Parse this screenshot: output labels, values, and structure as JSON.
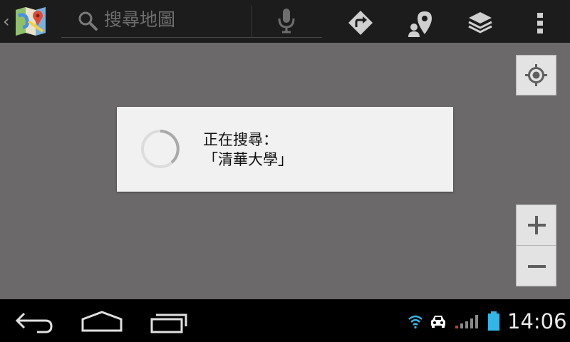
{
  "search": {
    "placeholder": "搜尋地圖"
  },
  "dialog": {
    "line1": "正在搜尋：",
    "line2": "「清華大學」"
  },
  "statusbar": {
    "time": "14:06"
  },
  "icons": {
    "app": "google-maps-icon",
    "search": "search-icon",
    "mic": "microphone-icon",
    "directions": "directions-icon",
    "places": "places-icon",
    "layers": "layers-icon",
    "overflow": "overflow-menu-icon",
    "locate": "my-location-icon",
    "back": "back-icon",
    "home": "home-icon",
    "recents": "recent-apps-icon",
    "wifi": "wifi-icon",
    "car": "car-icon",
    "signal": "signal-icon",
    "battery": "battery-icon"
  },
  "colors": {
    "actionbar": "#1c1c1c",
    "map": "#6b6969",
    "dialog": "#f1f1f1",
    "battery": "#33b5e5"
  }
}
